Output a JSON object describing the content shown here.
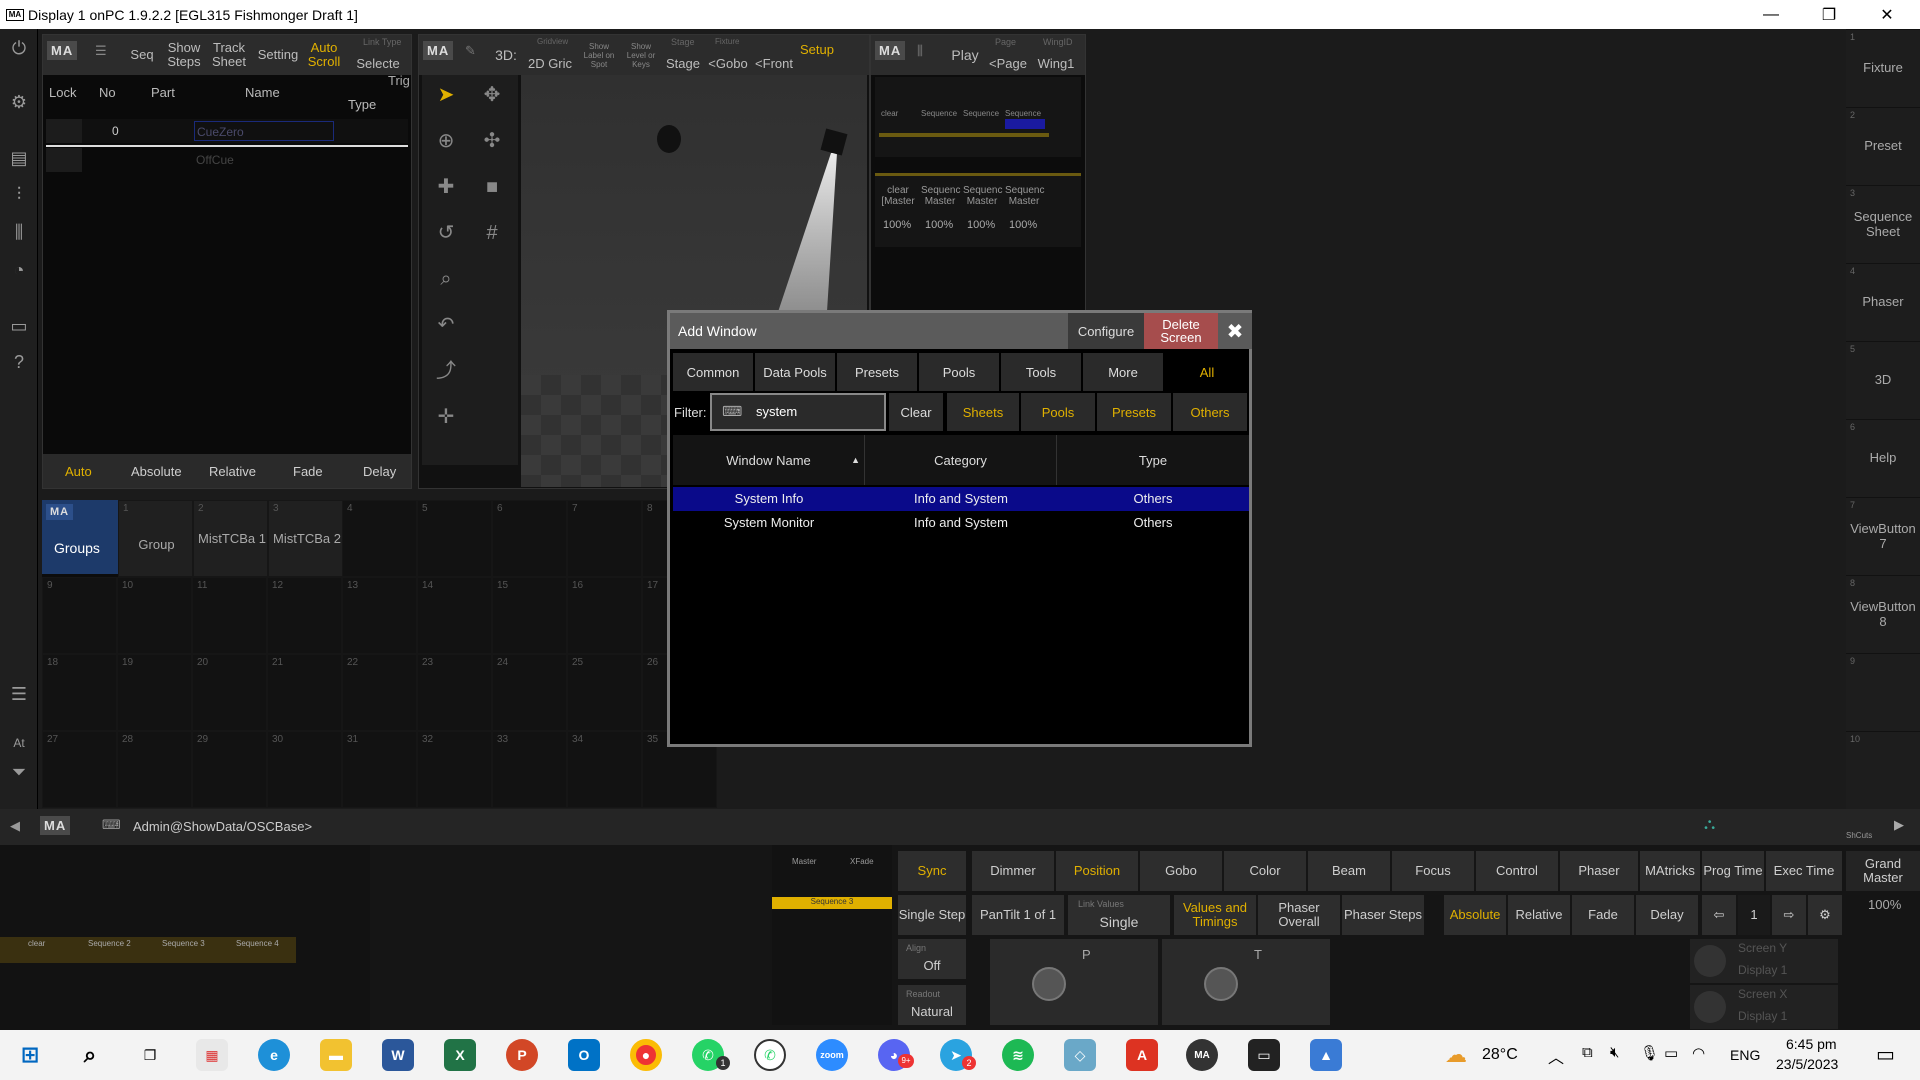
{
  "window": {
    "title": "Display 1 onPC 1.9.2.2 [EGL315 Fishmonger Draft 1]",
    "logo": "MA",
    "minimize": "—",
    "maximize": "❐",
    "close": "✕"
  },
  "left_sidebar": {
    "icons": [
      "power-icon",
      "gear-icon",
      "book-icon",
      "sliders-icon",
      "faders-icon",
      "user-icon",
      "monitor-icon",
      "help-icon",
      "list-icon",
      "at-icon",
      "filter-icon"
    ],
    "at_label": "At"
  },
  "sequence_panel": {
    "ma": "MA",
    "tabs": [
      "Seq",
      "Show Steps",
      "Track Sheet",
      "Setting",
      "Auto Scroll",
      "Selecte"
    ],
    "tab_small": "Link Type",
    "trig": "Trig",
    "columns": [
      "Lock",
      "No",
      "Part",
      "Name",
      "Type"
    ],
    "rows": [
      {
        "no": "0",
        "name": "CueZero"
      },
      {
        "no": "",
        "name": "OffCue"
      }
    ],
    "bottom": [
      "Auto",
      "Absolute",
      "Relative",
      "Fade",
      "Delay"
    ]
  },
  "viewer_panel": {
    "ma": "MA",
    "tabs": [
      "3D:",
      "2D Gric",
      "Show Label on Spot",
      "Show Level or Keys",
      "Stage",
      "<Gobo",
      "<Front",
      "Setup"
    ],
    "stage_small": "Stage",
    "gobo_small": "Fixture",
    "grid_small": "Gridview"
  },
  "playback_panel": {
    "ma": "MA",
    "play": "Play",
    "page_small": "Page",
    "page": "<Page",
    "wing_small": "WingID",
    "wing": "Wing1",
    "executors": [
      "clear",
      "Sequence",
      "Sequence",
      "Sequence"
    ],
    "masters": [
      "clear [Master",
      "Sequenc Master",
      "Sequenc Master",
      "Sequenc Master"
    ],
    "values": [
      "100%",
      "100%",
      "100%",
      "100%"
    ]
  },
  "groups_pool": {
    "ma": "MA",
    "title": "Groups",
    "items": [
      {
        "n": "1",
        "label": "Group"
      },
      {
        "n": "2",
        "label": "MistTCBa 1"
      },
      {
        "n": "3",
        "label": "MistTCBa 2"
      }
    ],
    "numbers": [
      "4",
      "5",
      "6",
      "7",
      "8",
      "9",
      "10",
      "11",
      "12",
      "13",
      "14",
      "15",
      "16",
      "17",
      "18",
      "19",
      "20",
      "21",
      "22",
      "23",
      "24",
      "25",
      "26",
      "27",
      "28",
      "29",
      "30",
      "31",
      "32",
      "33",
      "34",
      "35"
    ]
  },
  "right_sidebar": [
    {
      "n": "1",
      "label": "Fixture"
    },
    {
      "n": "2",
      "label": "Preset"
    },
    {
      "n": "3",
      "label": "Sequence Sheet"
    },
    {
      "n": "4",
      "label": "Phaser"
    },
    {
      "n": "5",
      "label": "3D"
    },
    {
      "n": "6",
      "label": "Help"
    },
    {
      "n": "7",
      "label": "ViewButton 7"
    },
    {
      "n": "8",
      "label": "ViewButton 8"
    },
    {
      "n": "9",
      "label": ""
    },
    {
      "n": "10",
      "label": ""
    }
  ],
  "dialog": {
    "title": "Add Window",
    "configure": "Configure",
    "delete_screen": "Delete Screen",
    "close": "✖",
    "tabs": [
      "Common",
      "Data Pools",
      "Presets",
      "Pools",
      "Tools",
      "More",
      "All"
    ],
    "filter_label": "Filter:",
    "filter_value": "system",
    "clear": "Clear",
    "filter_buttons": [
      "Sheets",
      "Pools",
      "Presets",
      "Others"
    ],
    "columns": [
      "Window Name",
      "Category",
      "Type"
    ],
    "sort_arrow": "▲",
    "rows": [
      {
        "name": "System Info",
        "category": "Info and System",
        "type": "Others",
        "selected": true
      },
      {
        "name": "System Monitor",
        "category": "Info and System",
        "type": "Others",
        "selected": false
      }
    ]
  },
  "command_line": {
    "ma": "MA",
    "prompt": "Admin@ShowData/OSCBase>",
    "shcuts": "ShCuts"
  },
  "executor_bar": {
    "master": "Master",
    "xfade": "XFade",
    "cue_label": "Sequence 3",
    "faders": [
      "clear",
      "Sequence 2",
      "Sequence 3",
      "Sequence 4"
    ]
  },
  "encoder_bar": {
    "top": [
      "Sync",
      "Dimmer",
      "Position",
      "Gobo",
      "Color",
      "Beam",
      "Focus",
      "Control",
      "Phaser",
      "MAtricks",
      "Prog Time",
      "Exec Time"
    ],
    "grand_master": "Grand Master",
    "grand_value": "100%",
    "row2": [
      "Single Step",
      "PanTilt 1 of 1"
    ],
    "link_small": "Link Values",
    "link_value": "Single",
    "values_timings": "Values and Timings",
    "phaser_overall": "Phaser Overall",
    "phaser_steps": "Phaser Steps",
    "modes": [
      "Absolute",
      "Relative",
      "Fade",
      "Delay"
    ],
    "page_num": "1",
    "align_small": "Align",
    "align_value": "Off",
    "readout_small": "Readout",
    "readout_value": "Natural",
    "encoder_p": "P",
    "encoder_t": "T",
    "screen_y": "Screen Y",
    "display_1a": "Display 1",
    "screen_x": "Screen X",
    "display_1b": "Display 1"
  },
  "taskbar": {
    "weather": "28°C",
    "lang": "ENG",
    "time": "6:45 pm",
    "date": "23/5/2023",
    "apps": [
      "start",
      "search",
      "taskview",
      "store",
      "edge",
      "files",
      "word",
      "excel",
      "powerpoint",
      "outlook",
      "chrome",
      "whatsapp-badge",
      "whatsapp",
      "zoom",
      "discord",
      "telegram",
      "spotify",
      "notes",
      "acrobat",
      "grandma",
      "terminal",
      "photos"
    ],
    "badges": {
      "whatsapp": "1",
      "telegram": "2",
      "discord": "9+"
    }
  },
  "colors": {
    "accent_yellow": "#e0b000",
    "selection_blue": "#0a0a8a",
    "delete_red": "#a64d4d"
  }
}
